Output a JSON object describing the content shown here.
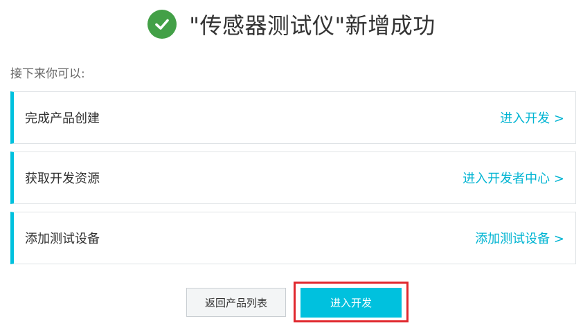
{
  "header": {
    "title": "\"传感器测试仪\"新增成功",
    "icon": "check-circle-icon",
    "icon_color": "#43a047"
  },
  "subtitle": "接下来你可以:",
  "cards": [
    {
      "label": "完成产品创建",
      "link": "进入开发 >"
    },
    {
      "label": "获取开发资源",
      "link": "进入开发者中心 >"
    },
    {
      "label": "添加测试设备",
      "link": "添加测试设备 >"
    }
  ],
  "buttons": {
    "back_label": "返回产品列表",
    "primary_label": "进入开发"
  },
  "colors": {
    "accent": "#00c1de",
    "link": "#00b4d2",
    "highlight": "#e0282e"
  }
}
